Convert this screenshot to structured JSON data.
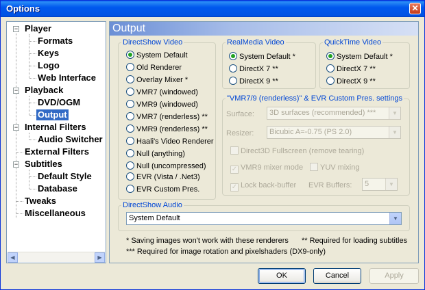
{
  "window": {
    "title": "Options",
    "close_glyph": "✕"
  },
  "tree": {
    "items": [
      {
        "label": "Player"
      },
      {
        "label": "Formats"
      },
      {
        "label": "Keys"
      },
      {
        "label": "Logo"
      },
      {
        "label": "Web Interface"
      },
      {
        "label": "Playback"
      },
      {
        "label": "DVD/OGM"
      },
      {
        "label": "Output"
      },
      {
        "label": "Internal Filters"
      },
      {
        "label": "Audio Switcher"
      },
      {
        "label": "External Filters"
      },
      {
        "label": "Subtitles"
      },
      {
        "label": "Default Style"
      },
      {
        "label": "Database"
      },
      {
        "label": "Tweaks"
      },
      {
        "label": "Miscellaneous"
      }
    ],
    "selected": "Output"
  },
  "header": {
    "title": "Output"
  },
  "directshow_video": {
    "legend": "DirectShow Video",
    "options": [
      "System Default",
      "Old Renderer",
      "Overlay Mixer *",
      "VMR7 (windowed)",
      "VMR9 (windowed)",
      "VMR7 (renderless) **",
      "VMR9 (renderless) **",
      "Haali's Video Renderer",
      "Null (anything)",
      "Null (uncompressed)",
      "EVR (Vista / .Net3)",
      "EVR Custom Pres."
    ],
    "selected_index": 0
  },
  "realmedia_video": {
    "legend": "RealMedia Video",
    "options": [
      "System Default *",
      "DirectX 7 **",
      "DirectX 9 **"
    ],
    "selected_index": 0
  },
  "quicktime_video": {
    "legend": "QuickTime Video",
    "options": [
      "System Default *",
      "DirectX 7 **",
      "DirectX 9 **"
    ],
    "selected_index": 0
  },
  "vmr_settings": {
    "legend": "\"VMR7/9 (renderless)\" & EVR Custom Pres. settings",
    "surface_label": "Surface:",
    "surface_value": "3D surfaces (recommended) ***",
    "resizer_label": "Resizer:",
    "resizer_value": "Bicubic A=-0.75 (PS 2.0)",
    "d3d_fullscreen": "Direct3D Fullscreen (remove tearing)",
    "vmr9_mixer": "VMR9 mixer mode",
    "yuv_mixing": "YUV mixing",
    "lock_backbuffer": "Lock back-buffer",
    "evr_buffers_label": "EVR Buffers:",
    "evr_buffers_value": "5"
  },
  "directshow_audio": {
    "legend": "DirectShow Audio",
    "value": "System Default"
  },
  "notes": {
    "n1": "* Saving images won't work with these renderers",
    "n2": "** Required for loading subtitles",
    "n3": "*** Required for image rotation and pixelshaders (DX9-only)"
  },
  "buttons": {
    "ok": "OK",
    "cancel": "Cancel",
    "apply": "Apply"
  },
  "glyphs": {
    "minus": "−",
    "dropdown": "▼",
    "left": "◀",
    "right": "▶",
    "check": "✓"
  }
}
